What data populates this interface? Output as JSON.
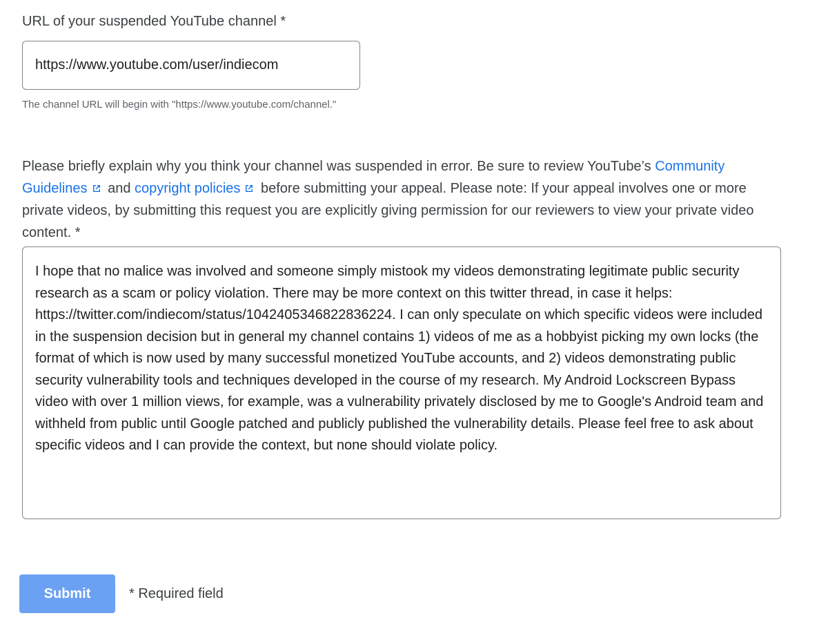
{
  "url_field": {
    "label": "URL of your suspended YouTube channel *",
    "value": "https://www.youtube.com/user/indiecom",
    "hint": "The channel URL will begin with \"https://www.youtube.com/channel.\""
  },
  "explanation_field": {
    "label_part1": "Please briefly explain why you think your channel was suspended in error. Be sure to review YouTube’s ",
    "link_community_guidelines": "Community Guidelines",
    "label_and": " and ",
    "link_copyright_policies": "copyright policies",
    "label_part2": " before submitting your appeal. Please note: If your appeal involves one or more private videos, by submitting this request you are explicitly giving permission for our reviewers to view your private video content. *",
    "value": "I hope that no malice was involved and someone simply mistook my videos demonstrating legitimate public security research as a scam or policy violation. There may be more context on this twitter thread, in case it helps: https://twitter.com/indiecom/status/1042405346822836224. I can only speculate on which specific videos were included in the suspension decision but in general my channel contains 1) videos of me as a hobbyist picking my own locks (the format of which is now used by many successful monetized YouTube accounts, and 2) videos demonstrating public security vulnerability tools and techniques developed in the course of my research. My Android Lockscreen Bypass video with over 1 million views, for example, was a vulnerability privately disclosed by me to Google's Android team and withheld from public until Google patched and publicly published the vulnerability details. Please feel free to ask about specific videos and I can provide the context, but none should violate policy."
  },
  "form_actions": {
    "submit_label": "Submit",
    "required_note": "* Required field"
  },
  "colors": {
    "link": "#1a73e8",
    "submit_bg": "#6ba1f3",
    "border": "#80868b"
  }
}
